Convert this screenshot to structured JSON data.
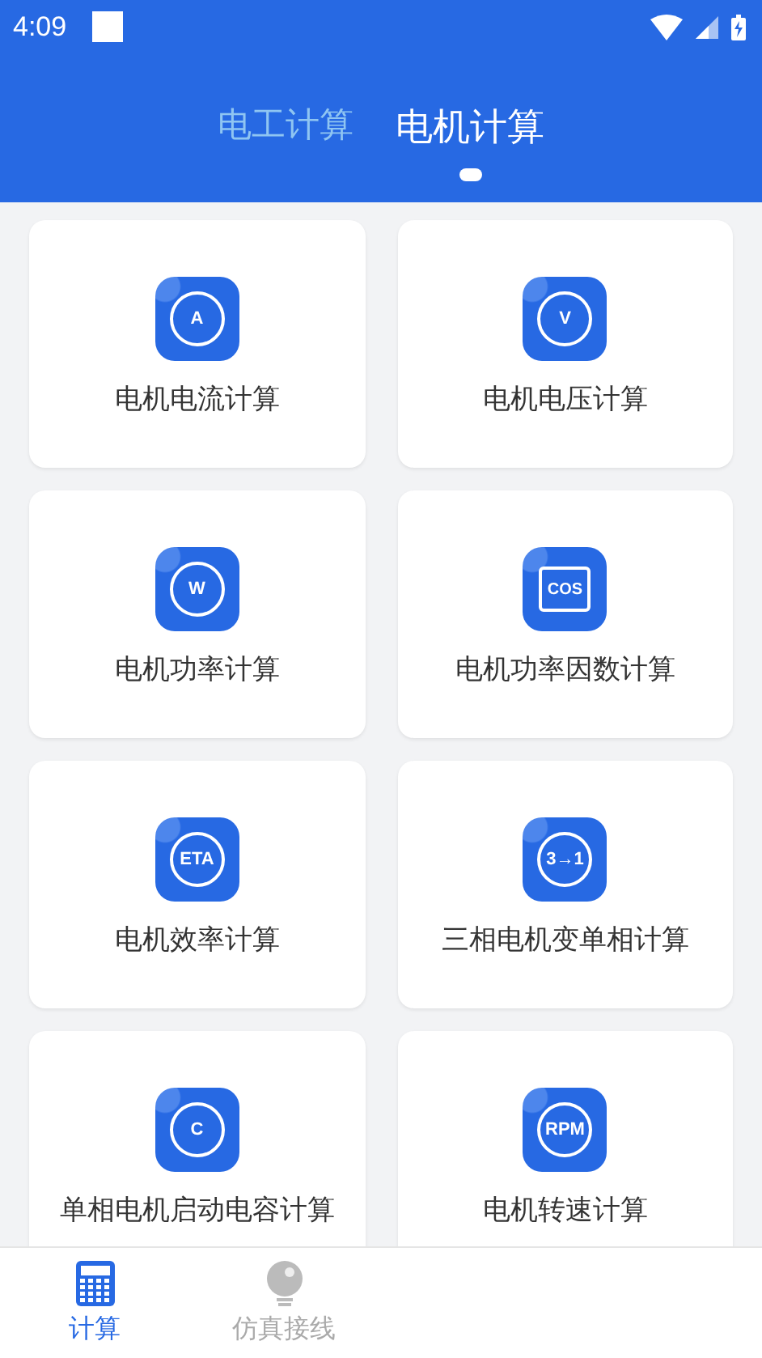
{
  "status_bar": {
    "time": "4:09"
  },
  "tabs": [
    {
      "label": "电工计算",
      "selected": false
    },
    {
      "label": "电机计算",
      "selected": true
    }
  ],
  "cards": [
    {
      "icon_text": "A",
      "kind": "circle",
      "label": "电机电流计算"
    },
    {
      "icon_text": "V",
      "kind": "circle",
      "label": "电机电压计算"
    },
    {
      "icon_text": "W",
      "kind": "circle",
      "label": "电机功率计算"
    },
    {
      "icon_text": "COS",
      "kind": "square",
      "label": "电机功率因数计算"
    },
    {
      "icon_text": "ETA",
      "kind": "circle",
      "label": "电机效率计算"
    },
    {
      "icon_text": "3→1",
      "kind": "circle",
      "label": "三相电机变单相计算"
    },
    {
      "icon_text": "C",
      "kind": "circle",
      "label": "单相电机启动电容计算"
    },
    {
      "icon_text": "RPM",
      "kind": "circle",
      "label": "电机转速计算"
    }
  ],
  "bottom_nav": [
    {
      "label": "计算",
      "kind": "calculator",
      "selected": true
    },
    {
      "label": "仿真接线",
      "kind": "bulb",
      "selected": false
    }
  ]
}
